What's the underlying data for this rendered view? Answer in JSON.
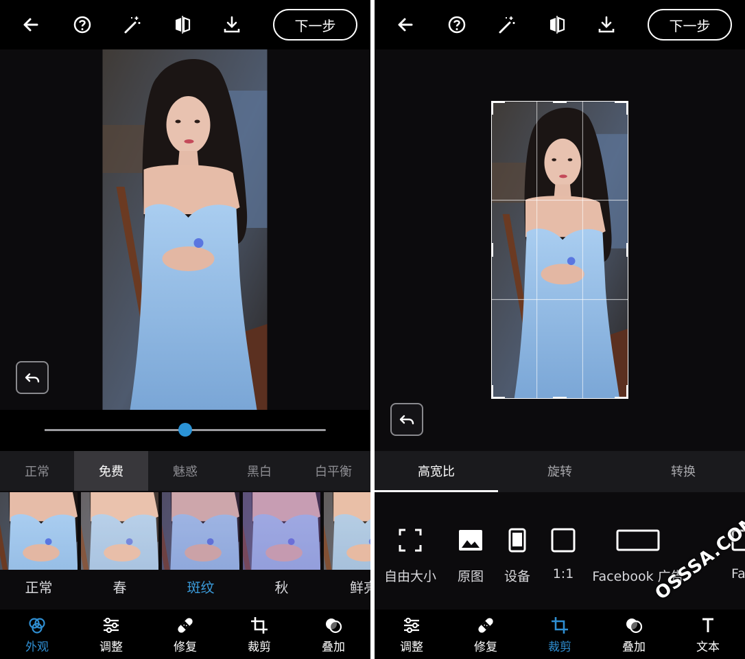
{
  "left": {
    "top_bar": {
      "next_label": "下一步"
    },
    "slider": {
      "value": 0.5
    },
    "categories": [
      {
        "label": "正常",
        "active": false
      },
      {
        "label": "免费",
        "active": true
      },
      {
        "label": "魅惑",
        "active": false
      },
      {
        "label": "黑白",
        "active": false
      },
      {
        "label": "白平衡",
        "active": false
      }
    ],
    "presets": [
      {
        "label": "正常",
        "active": false
      },
      {
        "label": "春",
        "active": false
      },
      {
        "label": "斑纹",
        "active": true
      },
      {
        "label": "秋",
        "active": false
      },
      {
        "label": "鲜亮",
        "active": false
      }
    ],
    "nav": [
      {
        "label": "外观",
        "icon": "looks-icon",
        "active": true
      },
      {
        "label": "调整",
        "icon": "sliders-icon",
        "active": false
      },
      {
        "label": "修复",
        "icon": "bandage-icon",
        "active": false
      },
      {
        "label": "裁剪",
        "icon": "crop-icon",
        "active": false
      },
      {
        "label": "叠加",
        "icon": "overlay-icon",
        "active": false
      }
    ]
  },
  "right": {
    "top_bar": {
      "next_label": "下一步"
    },
    "tabs": [
      {
        "label": "高宽比",
        "active": true
      },
      {
        "label": "旋转",
        "active": false
      },
      {
        "label": "转换",
        "active": false
      }
    ],
    "ratios": [
      {
        "label": "自由大小",
        "icon": "free-size-icon"
      },
      {
        "label": "原图",
        "icon": "original-image-icon"
      },
      {
        "label": "设备",
        "icon": "device-icon"
      },
      {
        "label": "1:1",
        "icon": "square-icon"
      },
      {
        "label": "Facebook 广告",
        "icon": "facebook-ad-icon"
      },
      {
        "label": "Facebo",
        "icon": "facebook-icon"
      }
    ],
    "nav": [
      {
        "label": "调整",
        "icon": "sliders-icon",
        "active": false
      },
      {
        "label": "修复",
        "icon": "bandage-icon",
        "active": false
      },
      {
        "label": "裁剪",
        "icon": "crop-icon",
        "active": true
      },
      {
        "label": "叠加",
        "icon": "overlay-icon",
        "active": false
      },
      {
        "label": "文本",
        "icon": "text-icon",
        "active": false
      }
    ]
  },
  "watermark": "OSSSA.COM",
  "colors": {
    "accent": "#2f8fd3",
    "background": "#0c0b0d",
    "topbar": "#000000"
  }
}
